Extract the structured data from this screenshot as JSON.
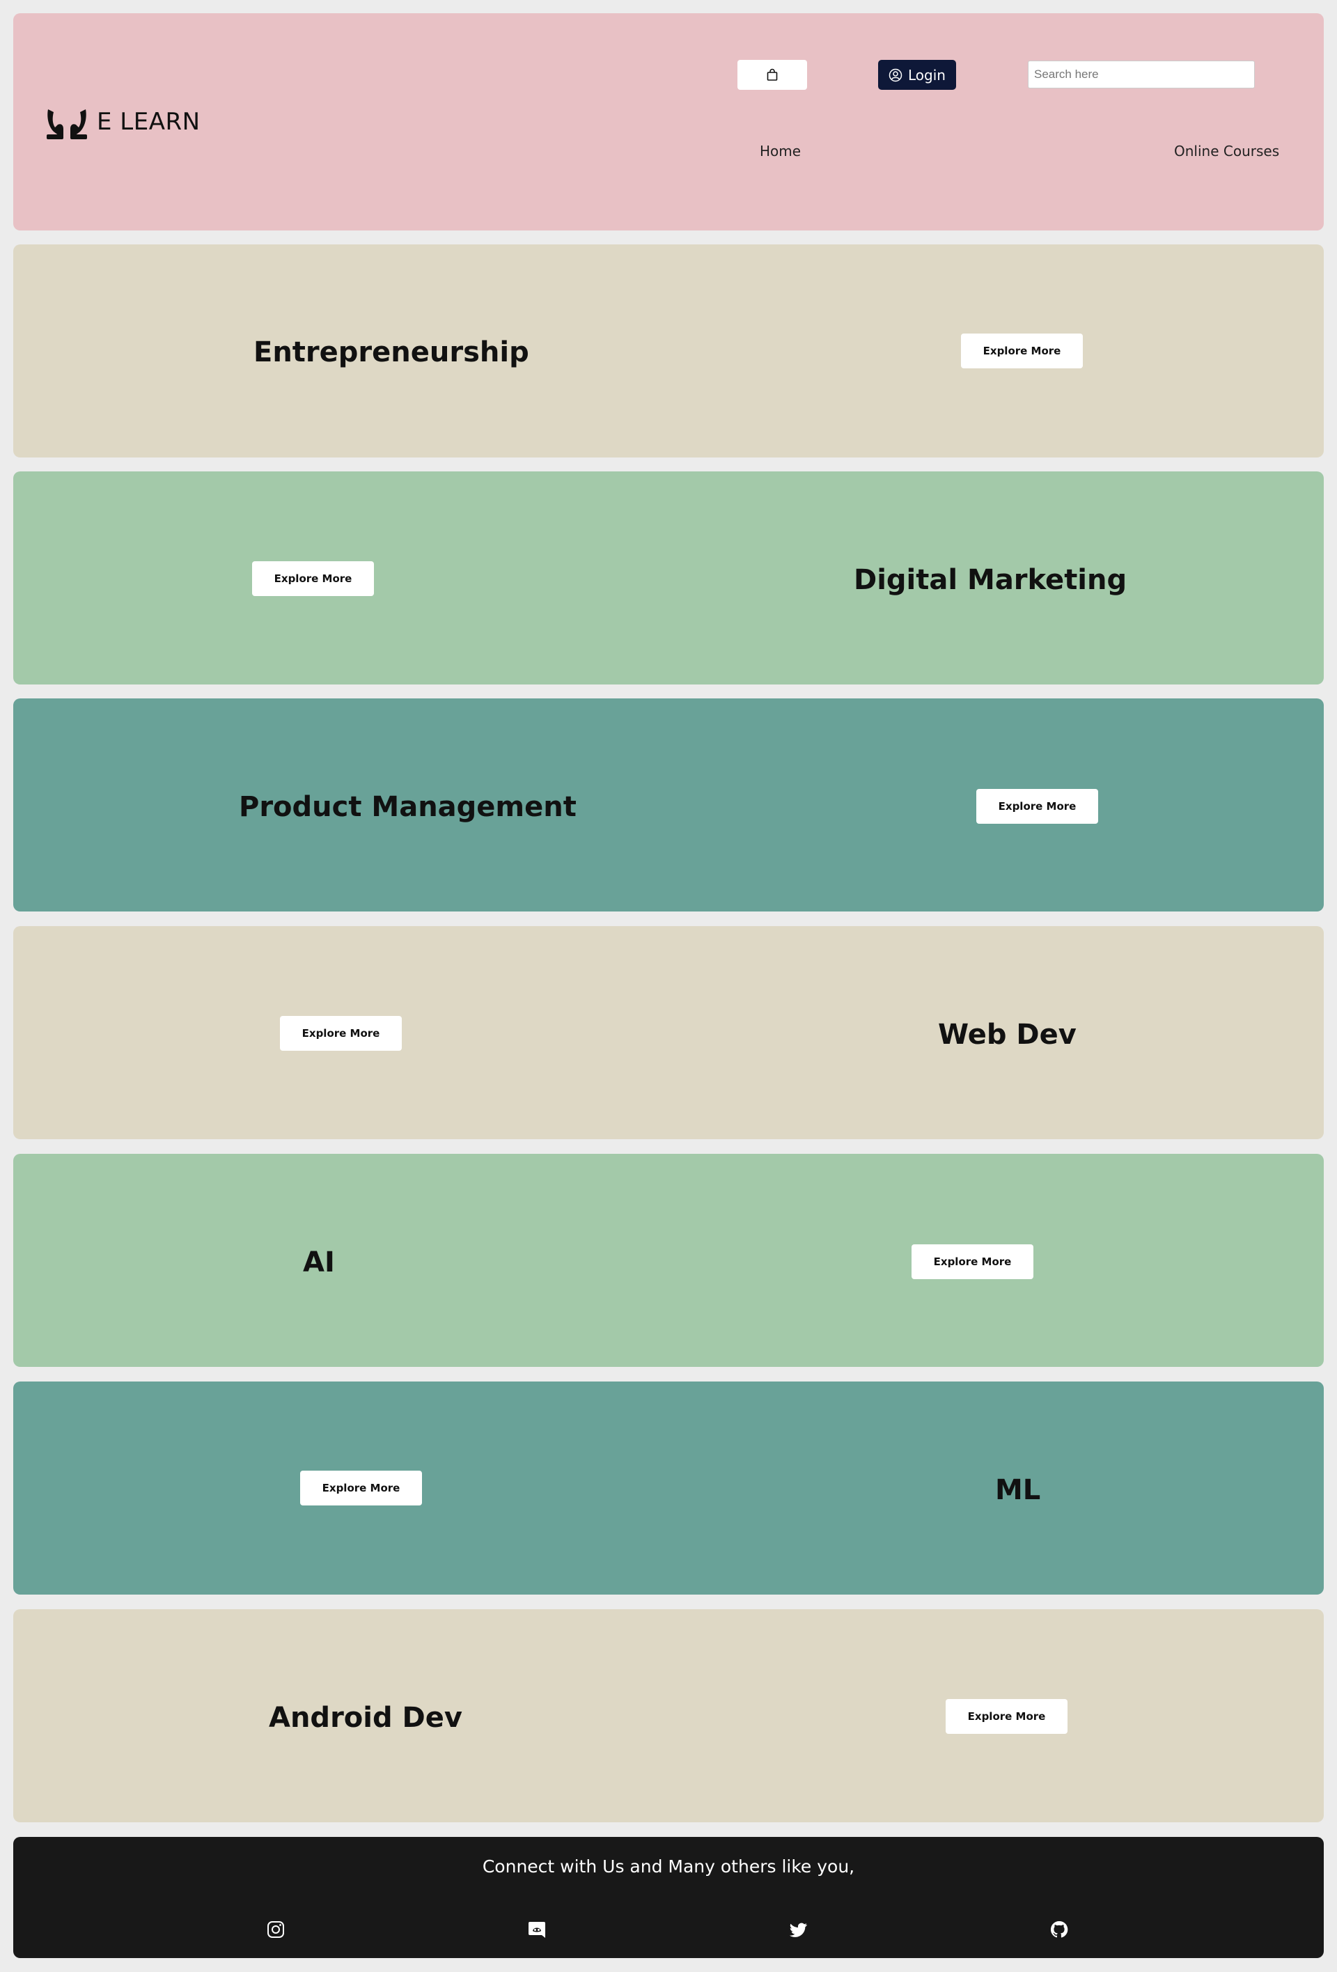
{
  "header": {
    "logo_text": "E LEARN",
    "login_label": "Login",
    "search_placeholder": "Search here",
    "nav": {
      "home": "Home",
      "courses": "Online Courses"
    }
  },
  "courses": [
    {
      "title": "Entrepreneurship",
      "button": "Explore More",
      "color": "#ded8c5"
    },
    {
      "title": "Digital Marketing",
      "button": "Explore More",
      "color": "#a3c9a9"
    },
    {
      "title": "Product Management",
      "button": "Explore More",
      "color": "#69a298"
    },
    {
      "title": "Web Dev",
      "button": "Explore More",
      "color": "#ded8c5"
    },
    {
      "title": "AI",
      "button": "Explore More",
      "color": "#a3c9a9"
    },
    {
      "title": "ML",
      "button": "Explore More",
      "color": "#69a298"
    },
    {
      "title": "Android Dev",
      "button": "Explore More",
      "color": "#ded8c5"
    }
  ],
  "footer": {
    "text": "Connect with Us and Many others like you,",
    "socials": [
      "instagram-icon",
      "discord-icon",
      "twitter-icon",
      "github-icon"
    ]
  }
}
